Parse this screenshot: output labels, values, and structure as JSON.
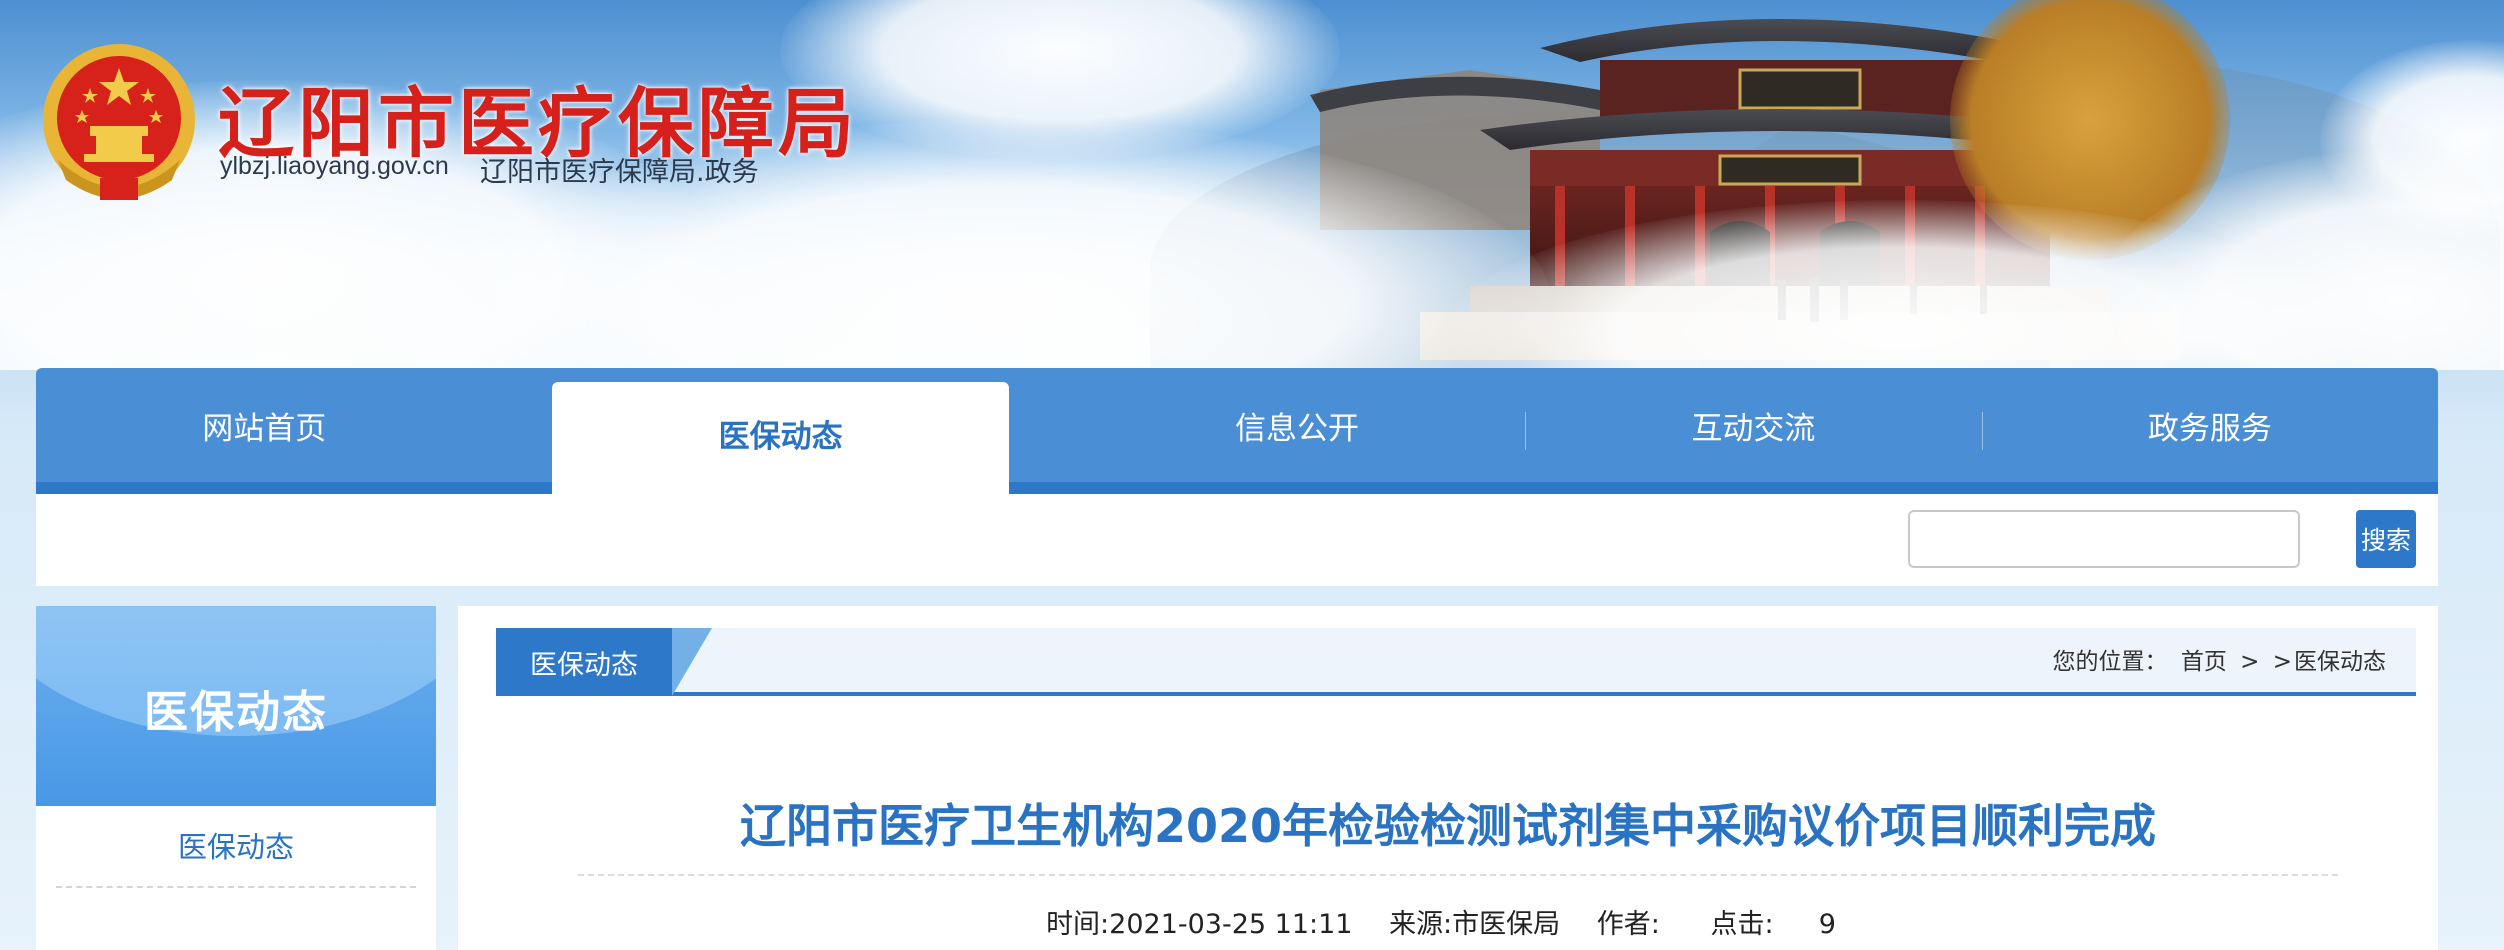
{
  "header": {
    "site_title": "辽阳市医疗保障局",
    "domain": "ylbzj.liaoyang.gov.cn",
    "subtitle": "辽阳市医疗保障局.政务"
  },
  "nav": {
    "items": [
      {
        "label": "网站首页"
      },
      {
        "label": "医保动态",
        "active": true
      },
      {
        "label": "信息公开"
      },
      {
        "label": "互动交流"
      },
      {
        "label": "政务服务"
      }
    ]
  },
  "search": {
    "value": "",
    "button_label": "搜索"
  },
  "sidebar": {
    "title": "医保动态",
    "items": [
      {
        "label": "医保动态"
      }
    ]
  },
  "breadcrumb": {
    "tab_label": "医保动态",
    "prefix": "您的位置：",
    "home": "首页",
    "sep1": ">",
    "sep2": ">",
    "current": "医保动态"
  },
  "article": {
    "title": "辽阳市医疗卫生机构2020年检验检测试剂集中采购议价项目顺利完成",
    "time": "时间:2021-03-25 11:11",
    "source": "来源:市医保局",
    "author": "作者:",
    "clicks_label": "点击:",
    "clicks": "9"
  },
  "colors": {
    "nav_blue": "#4a8fd6",
    "accent_blue": "#2d78c8",
    "title_red": "#d6201b",
    "link_blue": "#2a73c2"
  }
}
